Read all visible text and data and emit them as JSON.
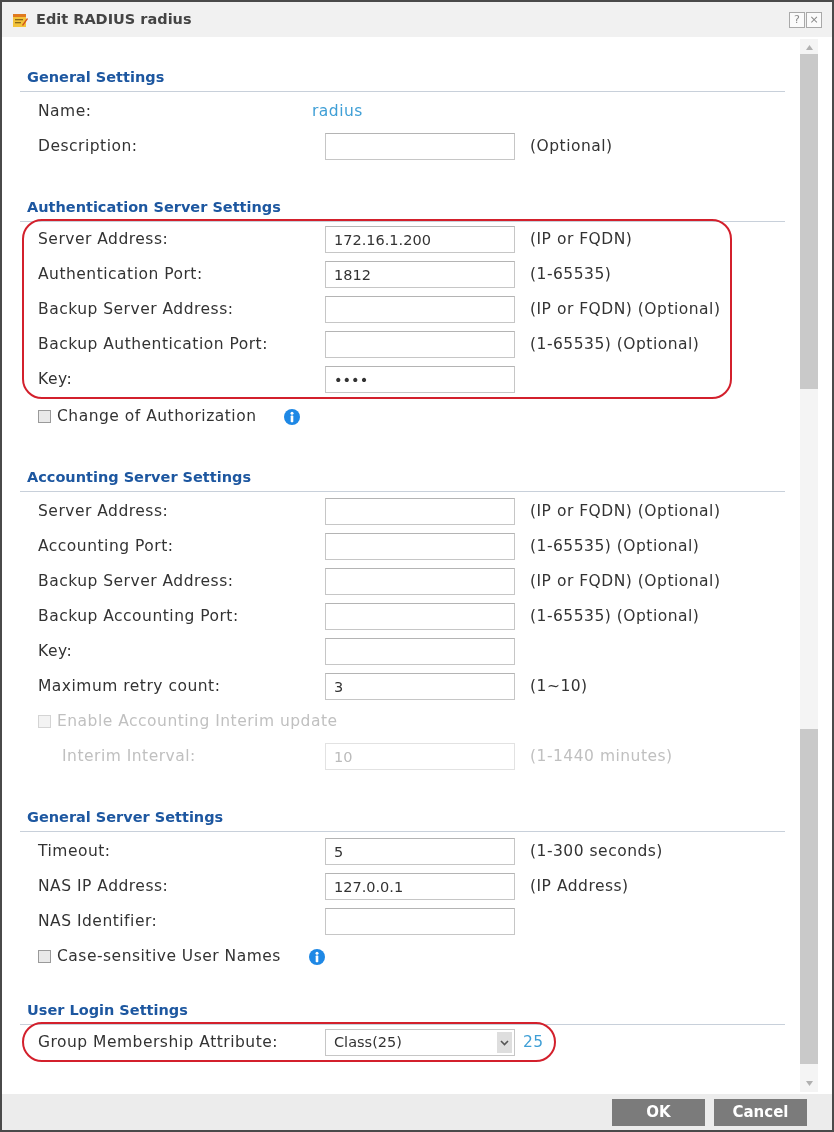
{
  "window": {
    "title": "Edit RADIUS radius",
    "title_buttons": [
      "?",
      "×"
    ]
  },
  "sections": [
    {
      "title": "General Settings",
      "rows": [
        {
          "kind": "static",
          "label": "Name:",
          "value": "radius",
          "highlighted": false,
          "disabled": false
        },
        {
          "kind": "field",
          "label": "Description:",
          "hint": "(Optional)",
          "highlighted": false,
          "disabled": false
        }
      ]
    },
    {
      "title": "Authentication Server Settings",
      "rows": [
        {
          "kind": "field",
          "label": "Server Address:",
          "value": "172.16.1.200",
          "hint": "(IP or FQDN)",
          "highlighted": true,
          "disabled": false
        },
        {
          "kind": "field",
          "label": "Authentication Port:",
          "value": "1812",
          "hint": "(1-65535)",
          "highlighted": true,
          "disabled": false
        },
        {
          "kind": "field",
          "label": "Backup Server Address:",
          "hint": "(IP or FQDN) (Optional)",
          "highlighted": true,
          "disabled": false
        },
        {
          "kind": "field",
          "label": "Backup Authentication Port:",
          "hint": "(1-65535) (Optional)",
          "highlighted": true,
          "disabled": false
        },
        {
          "kind": "field",
          "label": "Key:",
          "value": "••••",
          "highlighted": true,
          "disabled": false
        },
        {
          "kind": "checkbox",
          "label": "Change of Authorization",
          "checked": false,
          "info_icon": true,
          "highlighted": false,
          "disabled": false
        }
      ]
    },
    {
      "title": "Accounting Server Settings",
      "rows": [
        {
          "kind": "field",
          "label": "Server Address:",
          "hint": "(IP or FQDN) (Optional)",
          "highlighted": false,
          "disabled": false
        },
        {
          "kind": "field",
          "label": "Accounting Port:",
          "hint": "(1-65535) (Optional)",
          "highlighted": false,
          "disabled": false
        },
        {
          "kind": "field",
          "label": "Backup Server Address:",
          "hint": "(IP or FQDN) (Optional)",
          "highlighted": false,
          "disabled": false
        },
        {
          "kind": "field",
          "label": "Backup Accounting Port:",
          "hint": "(1-65535) (Optional)",
          "highlighted": false,
          "disabled": false
        },
        {
          "kind": "field",
          "label": "Key:",
          "highlighted": false,
          "disabled": false
        },
        {
          "kind": "field",
          "label": "Maximum retry count:",
          "value": "3",
          "hint": "(1~10)",
          "highlighted": false,
          "disabled": false
        },
        {
          "kind": "checkbox",
          "label": "Enable Accounting Interim update",
          "checked": false,
          "info_icon": false,
          "highlighted": false,
          "disabled": true,
          "children": [
            {
              "kind": "field",
              "label": "Interim Interval:",
              "value": "10",
              "hint": "(1-1440 minutes)",
              "highlighted": false,
              "disabled": true
            }
          ]
        }
      ]
    },
    {
      "title": "General Server Settings",
      "rows": [
        {
          "kind": "field",
          "label": "Timeout:",
          "value": "5",
          "hint": "(1-300 seconds)",
          "highlighted": false,
          "disabled": false
        },
        {
          "kind": "field",
          "label": "NAS IP Address:",
          "value": "127.0.0.1",
          "hint": "(IP Address)",
          "highlighted": false,
          "disabled": false
        },
        {
          "kind": "field",
          "label": "NAS Identifier:",
          "highlighted": false,
          "disabled": false
        },
        {
          "kind": "checkbox",
          "label": "Case-sensitive User Names",
          "checked": false,
          "info_icon": true,
          "highlighted": false,
          "disabled": false
        }
      ]
    },
    {
      "title": "User Login Settings",
      "rows": [
        {
          "kind": "select",
          "label": "Group Membership Attribute:",
          "value": "Class(25)",
          "suffix": "25",
          "highlighted": true,
          "disabled": false
        }
      ]
    }
  ],
  "buttons": [
    "OK",
    "Cancel"
  ]
}
